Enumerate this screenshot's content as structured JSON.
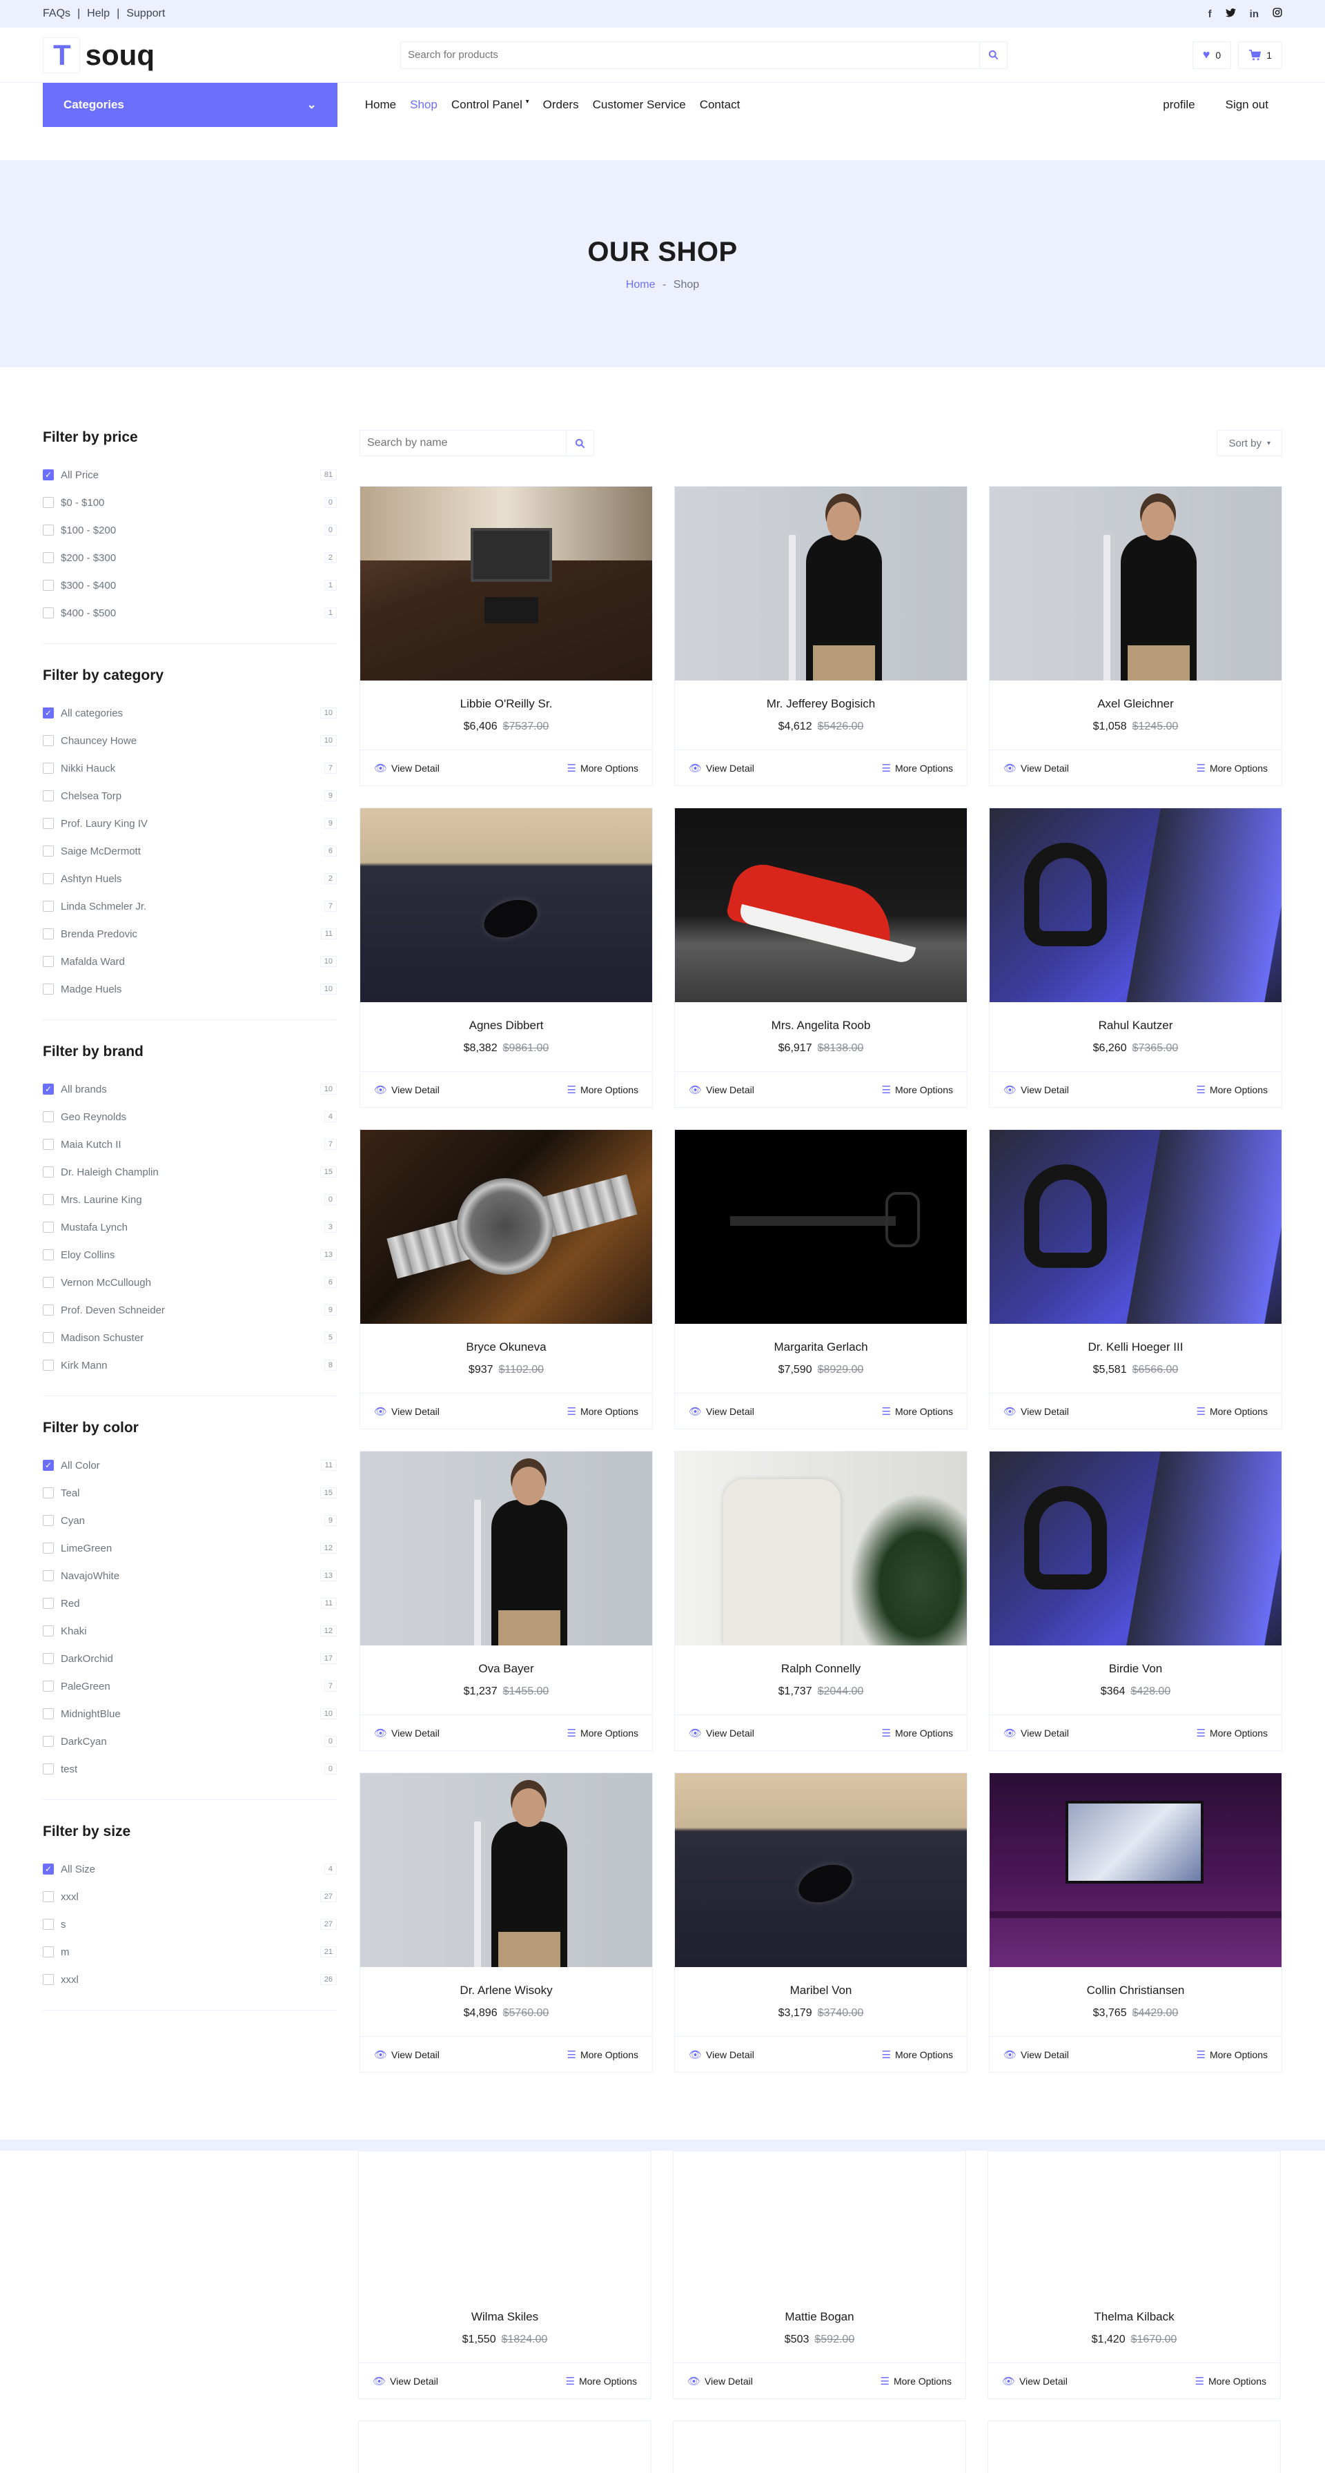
{
  "topbar": {
    "links": [
      "FAQs",
      "Help",
      "Support"
    ],
    "social_icons": [
      "facebook-icon",
      "twitter-icon",
      "linkedin-icon",
      "instagram-icon"
    ]
  },
  "header": {
    "logo_letter": "T",
    "logo_name": "souq",
    "search_placeholder": "Search for products",
    "wishlist_count": "0",
    "cart_count": "1"
  },
  "nav": {
    "categories_label": "Categories",
    "items": [
      "Home",
      "Shop",
      "Control Panel",
      "Orders",
      "Customer Service",
      "Contact"
    ],
    "active": "Shop",
    "right": [
      "profile",
      "Sign out"
    ]
  },
  "hero": {
    "title": "OUR SHOP",
    "crumb_home": "Home",
    "crumb_sep": "-",
    "crumb_current": "Shop"
  },
  "filters": {
    "price": {
      "title": "Filter by price",
      "options": [
        {
          "label": "All Price",
          "count": "81",
          "checked": true
        },
        {
          "label": "$0 - $100",
          "count": "0"
        },
        {
          "label": "$100 - $200",
          "count": "0"
        },
        {
          "label": "$200 - $300",
          "count": "2"
        },
        {
          "label": "$300 - $400",
          "count": "1"
        },
        {
          "label": "$400 - $500",
          "count": "1"
        }
      ]
    },
    "category": {
      "title": "Filter by category",
      "options": [
        {
          "label": "All categories",
          "count": "10",
          "checked": true
        },
        {
          "label": "Chauncey Howe",
          "count": "10"
        },
        {
          "label": "Nikki Hauck",
          "count": "7"
        },
        {
          "label": "Chelsea Torp",
          "count": "9"
        },
        {
          "label": "Prof. Laury King IV",
          "count": "9"
        },
        {
          "label": "Saige McDermott",
          "count": "6"
        },
        {
          "label": "Ashtyn Huels",
          "count": "2"
        },
        {
          "label": "Linda Schmeler Jr.",
          "count": "7"
        },
        {
          "label": "Brenda Predovic",
          "count": "11"
        },
        {
          "label": "Mafalda Ward",
          "count": "10"
        },
        {
          "label": "Madge Huels",
          "count": "10"
        }
      ]
    },
    "brand": {
      "title": "Filter by brand",
      "options": [
        {
          "label": "All brands",
          "count": "10",
          "checked": true
        },
        {
          "label": "Geo Reynolds",
          "count": "4"
        },
        {
          "label": "Maia Kutch II",
          "count": "7"
        },
        {
          "label": "Dr. Haleigh Champlin",
          "count": "15"
        },
        {
          "label": "Mrs. Laurine King",
          "count": "0"
        },
        {
          "label": "Mustafa Lynch",
          "count": "3"
        },
        {
          "label": "Eloy Collins",
          "count": "13"
        },
        {
          "label": "Vernon McCullough",
          "count": "6"
        },
        {
          "label": "Prof. Deven Schneider",
          "count": "9"
        },
        {
          "label": "Madison Schuster",
          "count": "5"
        },
        {
          "label": "Kirk Mann",
          "count": "8"
        }
      ]
    },
    "color": {
      "title": "Filter by color",
      "options": [
        {
          "label": "All Color",
          "count": "11",
          "checked": true
        },
        {
          "label": "Teal",
          "count": "15"
        },
        {
          "label": "Cyan",
          "count": "9"
        },
        {
          "label": "LimeGreen",
          "count": "12"
        },
        {
          "label": "NavajoWhite",
          "count": "13"
        },
        {
          "label": "Red",
          "count": "11"
        },
        {
          "label": "Khaki",
          "count": "12"
        },
        {
          "label": "DarkOrchid",
          "count": "17"
        },
        {
          "label": "PaleGreen",
          "count": "7"
        },
        {
          "label": "MidnightBlue",
          "count": "10"
        },
        {
          "label": "DarkCyan",
          "count": "0"
        },
        {
          "label": "test",
          "count": "0"
        }
      ]
    },
    "size": {
      "title": "Filter by size",
      "options": [
        {
          "label": "All Size",
          "count": "4",
          "checked": true
        },
        {
          "label": "xxxl",
          "count": "27"
        },
        {
          "label": "s",
          "count": "27"
        },
        {
          "label": "m",
          "count": "21"
        },
        {
          "label": "xxxl",
          "count": "26"
        }
      ]
    }
  },
  "shop": {
    "search_placeholder": "Search by name",
    "sort_label": "Sort by",
    "view_label": "View Detail",
    "more_label": "More Options",
    "products": [
      {
        "name": "Libbie O'Reilly Sr.",
        "price": "$6,406",
        "old": "$7537.00",
        "scene": "desk"
      },
      {
        "name": "Mr. Jefferey Bogisich",
        "price": "$4,612",
        "old": "$5426.00",
        "scene": "man"
      },
      {
        "name": "Axel Gleichner",
        "price": "$1,058",
        "old": "$1245.00",
        "scene": "man"
      },
      {
        "name": "Agnes Dibbert",
        "price": "$8,382",
        "old": "$9861.00",
        "scene": "mouse"
      },
      {
        "name": "Mrs. Angelita Roob",
        "price": "$6,917",
        "old": "$8138.00",
        "scene": "shoe"
      },
      {
        "name": "Rahul Kautzer",
        "price": "$6,260",
        "old": "$7365.00",
        "scene": "head"
      },
      {
        "name": "Bryce Okuneva",
        "price": "$937",
        "old": "$1102.00",
        "scene": "watch"
      },
      {
        "name": "Margarita Gerlach",
        "price": "$7,590",
        "old": "$8929.00",
        "scene": "dark"
      },
      {
        "name": "Dr. Kelli Hoeger III",
        "price": "$5,581",
        "old": "$6566.00",
        "scene": "head"
      },
      {
        "name": "Ova Bayer",
        "price": "$1,237",
        "old": "$1455.00",
        "scene": "man"
      },
      {
        "name": "Ralph Connelly",
        "price": "$1,737",
        "old": "$2044.00",
        "scene": "shirt"
      },
      {
        "name": "Birdie Von",
        "price": "$364",
        "old": "$428.00",
        "scene": "head"
      },
      {
        "name": "Dr. Arlene Wisoky",
        "price": "$4,896",
        "old": "$5760.00",
        "scene": "man"
      },
      {
        "name": "Maribel Von",
        "price": "$3,179",
        "old": "$3740.00",
        "scene": "mouse"
      },
      {
        "name": "Collin Christiansen",
        "price": "$3,765",
        "old": "$4429.00",
        "scene": "pc"
      }
    ],
    "lower_products": [
      {
        "name": "Wilma Skiles",
        "price": "$1,550",
        "old": "$1824.00"
      },
      {
        "name": "Mattie Bogan",
        "price": "$503",
        "old": "$592.00"
      },
      {
        "name": "Thelma Kilback",
        "price": "$1,420",
        "old": "$1670.00"
      }
    ]
  }
}
